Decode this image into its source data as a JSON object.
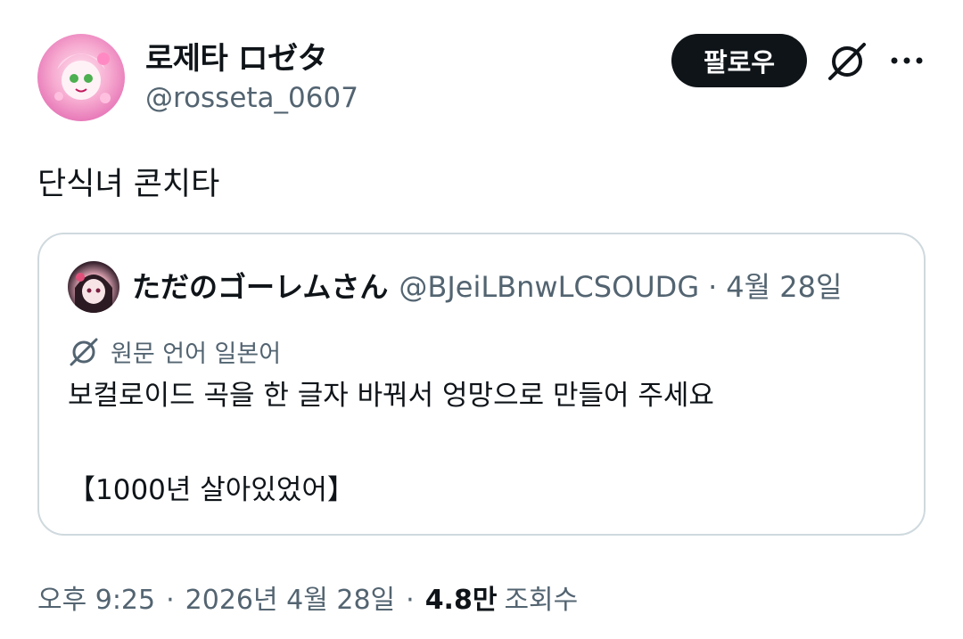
{
  "author": {
    "display_name": "로제타 ロゼタ",
    "handle": "@rosseta_0607"
  },
  "actions": {
    "follow_label": "팔로우",
    "grok_icon": "grok-icon",
    "more_icon": "more-icon"
  },
  "tweet": {
    "text": "단식녀 콘치타"
  },
  "quote": {
    "display_name": "ただのゴーレムさん",
    "handle": "@BJeiLBnwLCSOUDG",
    "separator": "·",
    "date": "4월 28일",
    "translate_label": "원문 언어 일본어",
    "body_line1": "보컬로이드 곡을 한 글자 바꿔서 엉망으로 만들어 주세요",
    "body_line2": "【1000년 살아있었어】"
  },
  "meta": {
    "time": "오후 9:25",
    "separator": "·",
    "date": "2026년 4월 28일",
    "separator2": "·",
    "views_count": "4.8만",
    "views_label": "조회수"
  },
  "colors": {
    "text_primary": "#0f1419",
    "text_secondary": "#536471",
    "border": "#cfd9de",
    "button_bg": "#0f1419"
  }
}
